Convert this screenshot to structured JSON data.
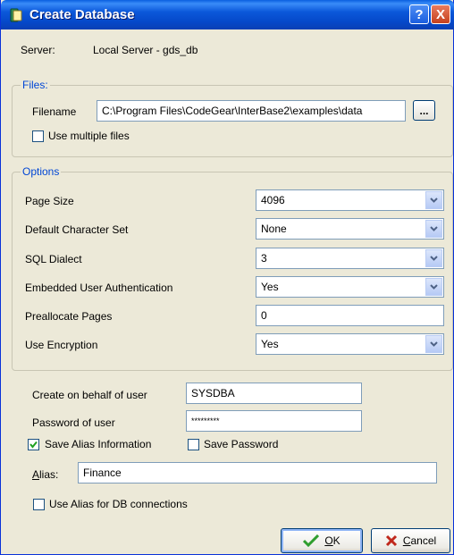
{
  "window": {
    "title": "Create Database",
    "help_label": "?",
    "close_label": "X"
  },
  "server": {
    "label": "Server:",
    "value": "Local Server - gds_db"
  },
  "files": {
    "legend": "Files:",
    "filename_label": "Filename",
    "filename_value": "C:\\Program Files\\CodeGear\\InterBase2\\examples\\data",
    "browse_label": "...",
    "multiple_files_label": "Use multiple files",
    "multiple_files_checked": false
  },
  "options": {
    "legend": "Options",
    "page_size": {
      "label": "Page Size",
      "value": "4096"
    },
    "charset": {
      "label": "Default Character Set",
      "value": "None"
    },
    "dialect": {
      "label": "SQL Dialect",
      "value": "3"
    },
    "embedded_auth": {
      "label": "Embedded User Authentication",
      "value": "Yes"
    },
    "preallocate": {
      "label": "Preallocate Pages",
      "value": "0"
    },
    "encryption": {
      "label": "Use Encryption",
      "value": "Yes"
    }
  },
  "user": {
    "behalf_label": "Create on behalf of user",
    "behalf_value": "SYSDBA",
    "password_label": "Password of user",
    "password_value": "*********",
    "save_alias_label": "Save Alias Information",
    "save_alias_checked": true,
    "save_password_label": "Save Password",
    "save_password_checked": false
  },
  "alias": {
    "label_first": "A",
    "label_rest": "lias:",
    "value": "Finance",
    "use_alias_label": "Use Alias for DB connections",
    "use_alias_checked": false
  },
  "buttons": {
    "ok_first": "O",
    "ok_rest": "K",
    "cancel_first": "C",
    "cancel_rest": "ancel"
  },
  "colors": {
    "title_bar": "#0A5FE0",
    "group_legend": "#0046D5",
    "window_bg": "#ECE9D8"
  }
}
